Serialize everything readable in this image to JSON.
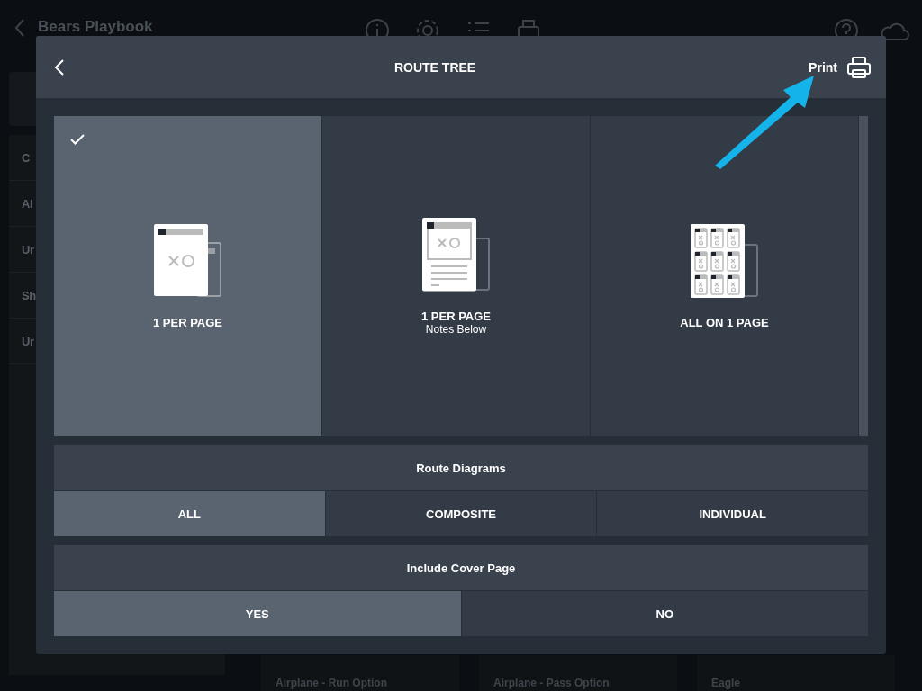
{
  "background": {
    "title": "Bears Playbook",
    "sidebar": [
      "C",
      "Al",
      "Ur",
      "Sh",
      "Ur"
    ],
    "cards": [
      "Airplane - Run Option",
      "Airplane - Pass Option",
      "Eagle"
    ]
  },
  "modal": {
    "title": "ROUTE TREE",
    "print": "Print",
    "layouts": [
      {
        "kind": "single",
        "label": "1 PER PAGE",
        "selected": true
      },
      {
        "kind": "notes",
        "label": "1 PER PAGE",
        "sublabel": "Notes Below",
        "selected": false
      },
      {
        "kind": "grid",
        "label": "ALL ON 1 PAGE",
        "selected": false
      }
    ],
    "sections": [
      {
        "title": "Route Diagrams",
        "options": [
          {
            "label": "ALL",
            "selected": true
          },
          {
            "label": "COMPOSITE",
            "selected": false
          },
          {
            "label": "INDIVIDUAL",
            "selected": false
          }
        ]
      },
      {
        "title": "Include Cover Page",
        "options": [
          {
            "label": "YES",
            "selected": true
          },
          {
            "label": "NO",
            "selected": false
          }
        ]
      }
    ]
  }
}
